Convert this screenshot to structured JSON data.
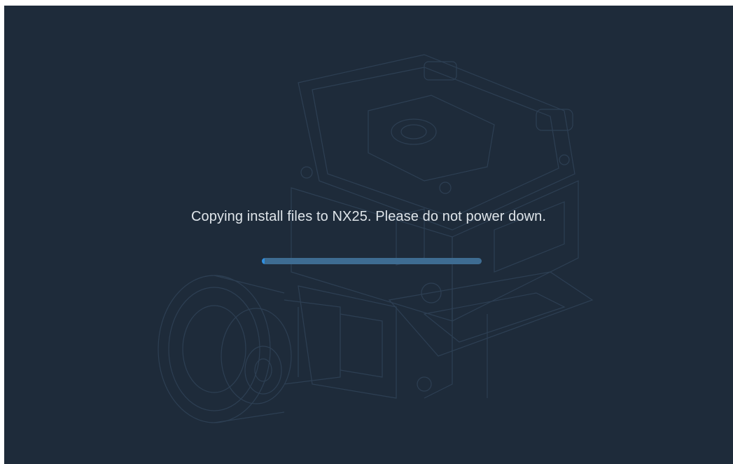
{
  "install": {
    "message": "Copying install files to NX25. Please do not power down.",
    "progress": 0.01,
    "progress_color": "#2f8fe0",
    "track_color": "#3e6c92",
    "background_color": "#1e2b3a"
  },
  "background": {
    "illustration": "engine-blueprint-illustration"
  }
}
